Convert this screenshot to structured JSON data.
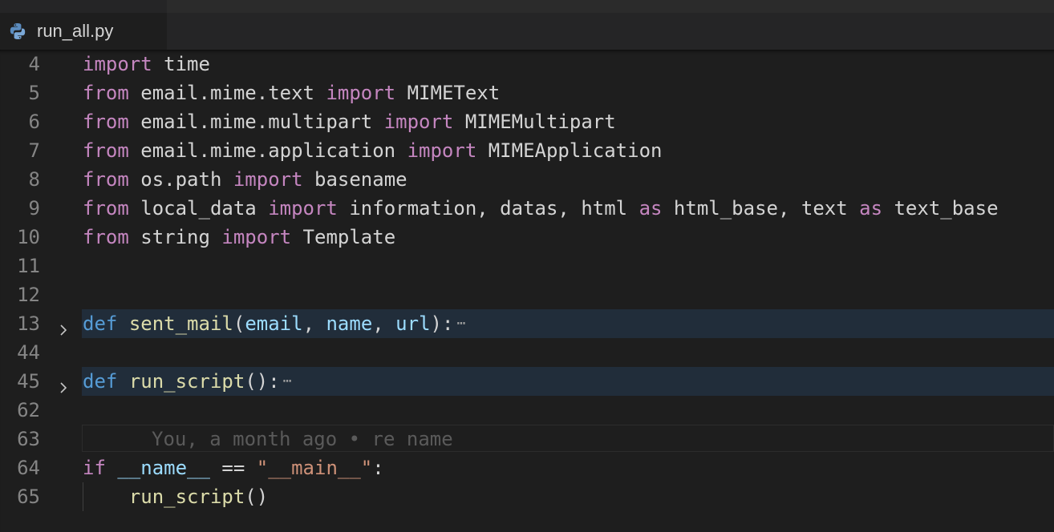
{
  "tab": {
    "filename": "run_all.py",
    "icon": "python-icon"
  },
  "editor": {
    "lines": [
      {
        "num": "4",
        "tokens": [
          {
            "t": "import",
            "c": "kw"
          },
          {
            "t": " time",
            "c": ""
          }
        ]
      },
      {
        "num": "5",
        "tokens": [
          {
            "t": "from",
            "c": "kw"
          },
          {
            "t": " email.mime.text ",
            "c": ""
          },
          {
            "t": "import",
            "c": "kw"
          },
          {
            "t": " MIMEText",
            "c": ""
          }
        ]
      },
      {
        "num": "6",
        "tokens": [
          {
            "t": "from",
            "c": "kw"
          },
          {
            "t": " email.mime.multipart ",
            "c": ""
          },
          {
            "t": "import",
            "c": "kw"
          },
          {
            "t": " MIMEMultipart",
            "c": ""
          }
        ]
      },
      {
        "num": "7",
        "tokens": [
          {
            "t": "from",
            "c": "kw"
          },
          {
            "t": " email.mime.application ",
            "c": ""
          },
          {
            "t": "import",
            "c": "kw"
          },
          {
            "t": " MIMEApplication",
            "c": ""
          }
        ]
      },
      {
        "num": "8",
        "tokens": [
          {
            "t": "from",
            "c": "kw"
          },
          {
            "t": " os.path ",
            "c": ""
          },
          {
            "t": "import",
            "c": "kw"
          },
          {
            "t": " basename",
            "c": ""
          }
        ]
      },
      {
        "num": "9",
        "tokens": [
          {
            "t": "from",
            "c": "kw"
          },
          {
            "t": " local_data ",
            "c": ""
          },
          {
            "t": "import",
            "c": "kw"
          },
          {
            "t": " information, datas, html ",
            "c": ""
          },
          {
            "t": "as",
            "c": "kw"
          },
          {
            "t": " html_base, text ",
            "c": ""
          },
          {
            "t": "as",
            "c": "kw"
          },
          {
            "t": " text_base",
            "c": ""
          }
        ]
      },
      {
        "num": "10",
        "tokens": [
          {
            "t": "from",
            "c": "kw"
          },
          {
            "t": " string ",
            "c": ""
          },
          {
            "t": "import",
            "c": "kw"
          },
          {
            "t": " Template",
            "c": ""
          }
        ]
      },
      {
        "num": "11",
        "tokens": []
      },
      {
        "num": "12",
        "tokens": []
      },
      {
        "num": "13",
        "folded": true,
        "tokens": [
          {
            "t": "def",
            "c": "def"
          },
          {
            "t": " ",
            "c": ""
          },
          {
            "t": "sent_mail",
            "c": "fn"
          },
          {
            "t": "(",
            "c": ""
          },
          {
            "t": "email",
            "c": "param"
          },
          {
            "t": ", ",
            "c": ""
          },
          {
            "t": "name",
            "c": "param"
          },
          {
            "t": ", ",
            "c": ""
          },
          {
            "t": "url",
            "c": "param"
          },
          {
            "t": "):",
            "c": ""
          }
        ]
      },
      {
        "num": "44",
        "tokens": []
      },
      {
        "num": "45",
        "folded": true,
        "tokens": [
          {
            "t": "def",
            "c": "def"
          },
          {
            "t": " ",
            "c": ""
          },
          {
            "t": "run_script",
            "c": "fn"
          },
          {
            "t": "():",
            "c": ""
          }
        ]
      },
      {
        "num": "62",
        "tokens": []
      },
      {
        "num": "63",
        "blame": "You, a month ago • re name",
        "tokens": []
      },
      {
        "num": "64",
        "tokens": [
          {
            "t": "if",
            "c": "kw"
          },
          {
            "t": " ",
            "c": ""
          },
          {
            "t": "__name__",
            "c": "dunder"
          },
          {
            "t": " == ",
            "c": ""
          },
          {
            "t": "\"__main__\"",
            "c": "str"
          },
          {
            "t": ":",
            "c": ""
          }
        ]
      },
      {
        "num": "65",
        "indent": true,
        "tokens": [
          {
            "t": "    ",
            "c": ""
          },
          {
            "t": "run_script",
            "c": "fn"
          },
          {
            "t": "()",
            "c": ""
          }
        ]
      }
    ],
    "fold_ellipsis": "⋯"
  }
}
